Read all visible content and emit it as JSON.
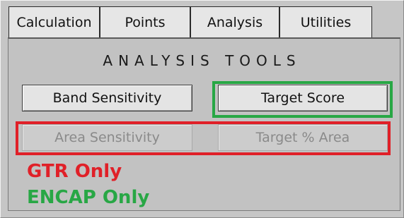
{
  "tabs": [
    {
      "label": "Calculation"
    },
    {
      "label": "Points"
    },
    {
      "label": "Analysis"
    },
    {
      "label": "Utilities"
    }
  ],
  "section_title": "ANALYSIS TOOLS",
  "buttons": {
    "band_sensitivity": "Band Sensitivity",
    "target_score": "Target Score",
    "area_sensitivity": "Area Sensitivity",
    "target_pct_area": "Target % Area"
  },
  "annotations": {
    "gtr_only": "GTR Only",
    "encap_only": "ENCAP Only"
  },
  "colors": {
    "gtr_red": "#e02028",
    "encap_green": "#28a745"
  }
}
